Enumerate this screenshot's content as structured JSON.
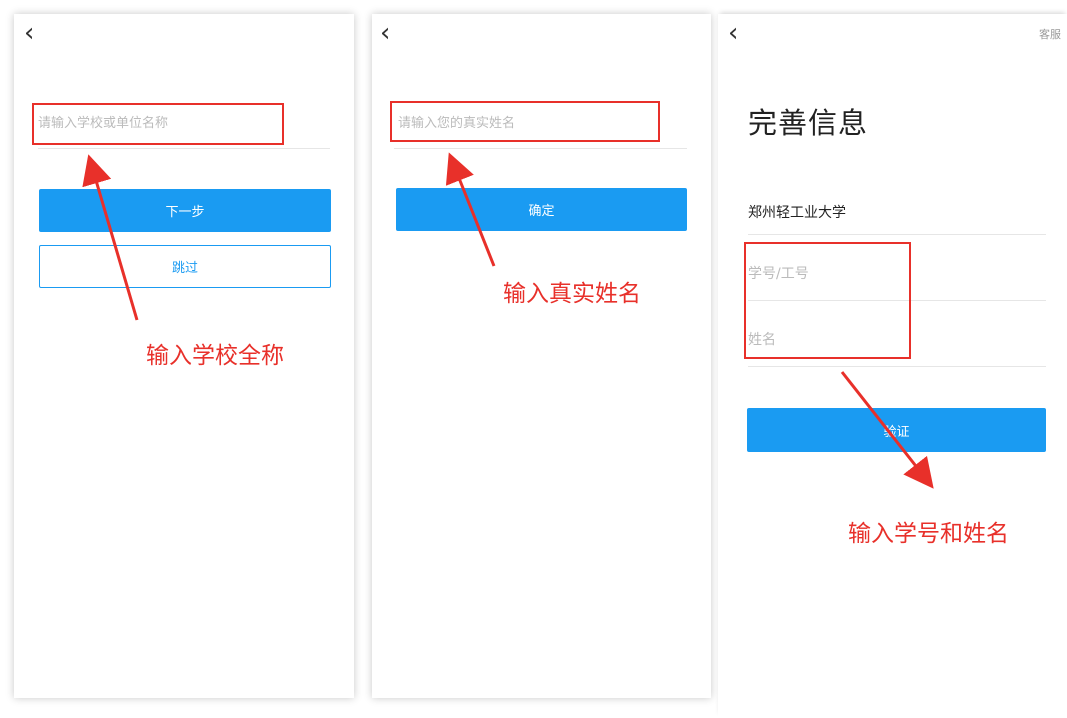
{
  "screen1": {
    "back_icon": "‹",
    "school_input": {
      "placeholder": "请输入学校或单位名称",
      "value": ""
    },
    "next_label": "下一步",
    "skip_label": "跳过",
    "annotation": "输入学校全称"
  },
  "screen2": {
    "back_icon": "‹",
    "name_input": {
      "placeholder": "请输入您的真实姓名",
      "value": ""
    },
    "confirm_label": "确定",
    "annotation": "输入真实姓名"
  },
  "screen3": {
    "back_icon": "‹",
    "support_label": "客服",
    "title": "完善信息",
    "school_name": "郑州轻工业大学",
    "id_input": {
      "placeholder": "学号/工号",
      "value": ""
    },
    "name_input": {
      "placeholder": "姓名",
      "value": ""
    },
    "verify_label": "验证",
    "annotation": "输入学号和姓名"
  },
  "colors": {
    "accent": "#1a9bf2",
    "annotation_red": "#e8302a"
  }
}
